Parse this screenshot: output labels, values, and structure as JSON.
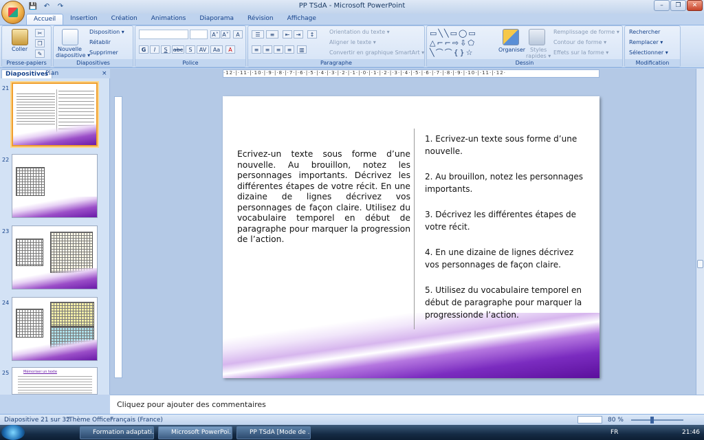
{
  "window": {
    "title": "PP TSdA - Microsoft PowerPoint",
    "minimize": "–",
    "restore": "❐",
    "close": "✕"
  },
  "qat": {
    "save": "💾",
    "undo": "↶",
    "redo": "↷"
  },
  "tabs": [
    "Accueil",
    "Insertion",
    "Création",
    "Animations",
    "Diaporama",
    "Révision",
    "Affichage"
  ],
  "ribbon": {
    "clipboard": {
      "label": "Presse-papiers",
      "paste": "Coller"
    },
    "slides": {
      "label": "Diapositives",
      "new_slide": "Nouvelle",
      "new_slide2": "diapositive ▾",
      "layout": "Disposition ▾",
      "reset": "Rétablir",
      "delete": "Supprimer"
    },
    "font": {
      "label": "Police",
      "bold": "G",
      "italic": "I",
      "underline": "S",
      "strike": "abc",
      "shadow": "S",
      "spacing": "AV",
      "case": "Aa",
      "color": "A",
      "grow": "A˄",
      "shrink": "A˅",
      "clear": "A"
    },
    "paragraph": {
      "label": "Paragraphe",
      "text_dir": "Orientation du texte ▾",
      "align_text": "Aligner le texte ▾",
      "smartart": "Convertir en graphique SmartArt ▾"
    },
    "drawing": {
      "label": "Dessin",
      "arrange": "Organiser",
      "quick_styles": "Styles",
      "quick_styles2": "rapides ▾",
      "fill": "Remplissage de forme ▾",
      "outline": "Contour de forme ▾",
      "effects": "Effets sur la forme ▾"
    },
    "editing": {
      "label": "Modification",
      "find": "Rechercher",
      "replace": "Remplacer ▾",
      "select": "Sélectionner ▾"
    }
  },
  "left_panel": {
    "tab_slides": "Diapositives",
    "tab_outline": "Plan",
    "close": "×",
    "slide_numbers": [
      "21",
      "22",
      "23",
      "24",
      "25"
    ],
    "slide25_title": "Mémoriser un texte"
  },
  "ruler_h": "·12·|·11·|·10·|·9·|·8·|·7·|·6·|·5·|·4·|·3·|·2·|·1·|·0·|·1·|·2·|·3·|·4·|·5·|·6·|·7·|·8·|·9·|·10·|·11·|·12·",
  "slide": {
    "left_text": "Ecrivez-un texte sous forme d’une nouvelle. Au brouillon, notez les personnages importants. Décrivez les différentes étapes de votre récit. En une dizaine de lignes décrivez vos personnages de façon claire. Utilisez du vocabulaire temporel en début de paragraphe pour marquer la progression de l’action.",
    "right_items": [
      "1. Ecrivez-un texte sous forme d’une nouvelle.",
      "2. Au brouillon, notez les personnages importants.",
      "3. Décrivez les différentes étapes de votre récit.",
      "4. En une dizaine de lignes décrivez vos personnages de façon claire.",
      "5. Utilisez du vocabulaire temporel en début de paragraphe pour marquer la progressionde l’action."
    ]
  },
  "notes_placeholder": "Cliquez pour ajouter des commentaires",
  "status": {
    "slide_info": "Diapositive 21 sur 32",
    "theme": "\"Thème Office\"",
    "language": "Français (France)",
    "zoom": "80 %"
  },
  "taskbar": {
    "buttons": [
      "Formation adaptati...",
      "Microsoft PowerPoi...",
      "PP TSdA [Mode de ..."
    ],
    "lang": "FR",
    "time": "21:46"
  }
}
